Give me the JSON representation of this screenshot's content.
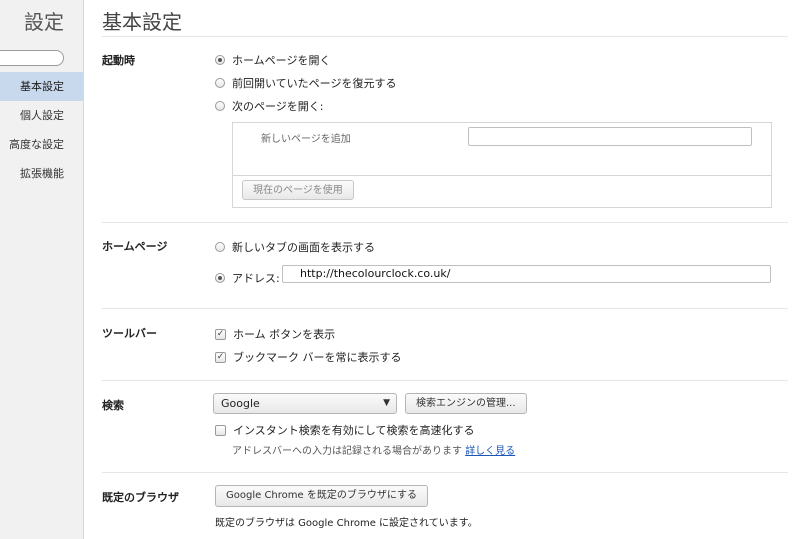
{
  "sidebar": {
    "title": "設定",
    "items": [
      {
        "label": "基本設定",
        "active": true
      },
      {
        "label": "個人設定",
        "active": false
      },
      {
        "label": "高度な設定",
        "active": false
      },
      {
        "label": "拡張機能",
        "active": false
      }
    ]
  },
  "page": {
    "title": "基本設定"
  },
  "startup": {
    "label": "起動時",
    "options": [
      "ホームページを開く",
      "前回開いていたページを復元する",
      "次のページを開く:"
    ],
    "selected_index": 0,
    "add_page_label": "新しいページを追加",
    "use_current_button": "現在のページを使用"
  },
  "homepage": {
    "label": "ホームページ",
    "new_tab_option": "新しいタブの画面を表示する",
    "address_option": "アドレス:",
    "address_value": "http://thecolourclock.co.uk/",
    "selected": "address"
  },
  "toolbar": {
    "label": "ツールバー",
    "show_home": "ホーム ボタンを表示",
    "show_bookmarks": "ブックマーク バーを常に表示する",
    "show_home_checked": true,
    "show_bookmarks_checked": true
  },
  "search": {
    "label": "検索",
    "engine": "Google",
    "manage_button": "検索エンジンの管理...",
    "instant_option": "インスタント検索を有効にして検索を高速化する",
    "instant_checked": false,
    "hint": "アドレスバーへの入力は記録される場合があります",
    "learn_more": "詳しく見る"
  },
  "default_browser": {
    "label": "既定のブラウザ",
    "button": "Google Chrome を既定のブラウザにする",
    "status": "既定のブラウザは Google Chrome に設定されています。"
  },
  "icons": {
    "radio_checked": "radio-dot",
    "checkbox_checked": "✓",
    "dropdown_arrow": "▼"
  }
}
